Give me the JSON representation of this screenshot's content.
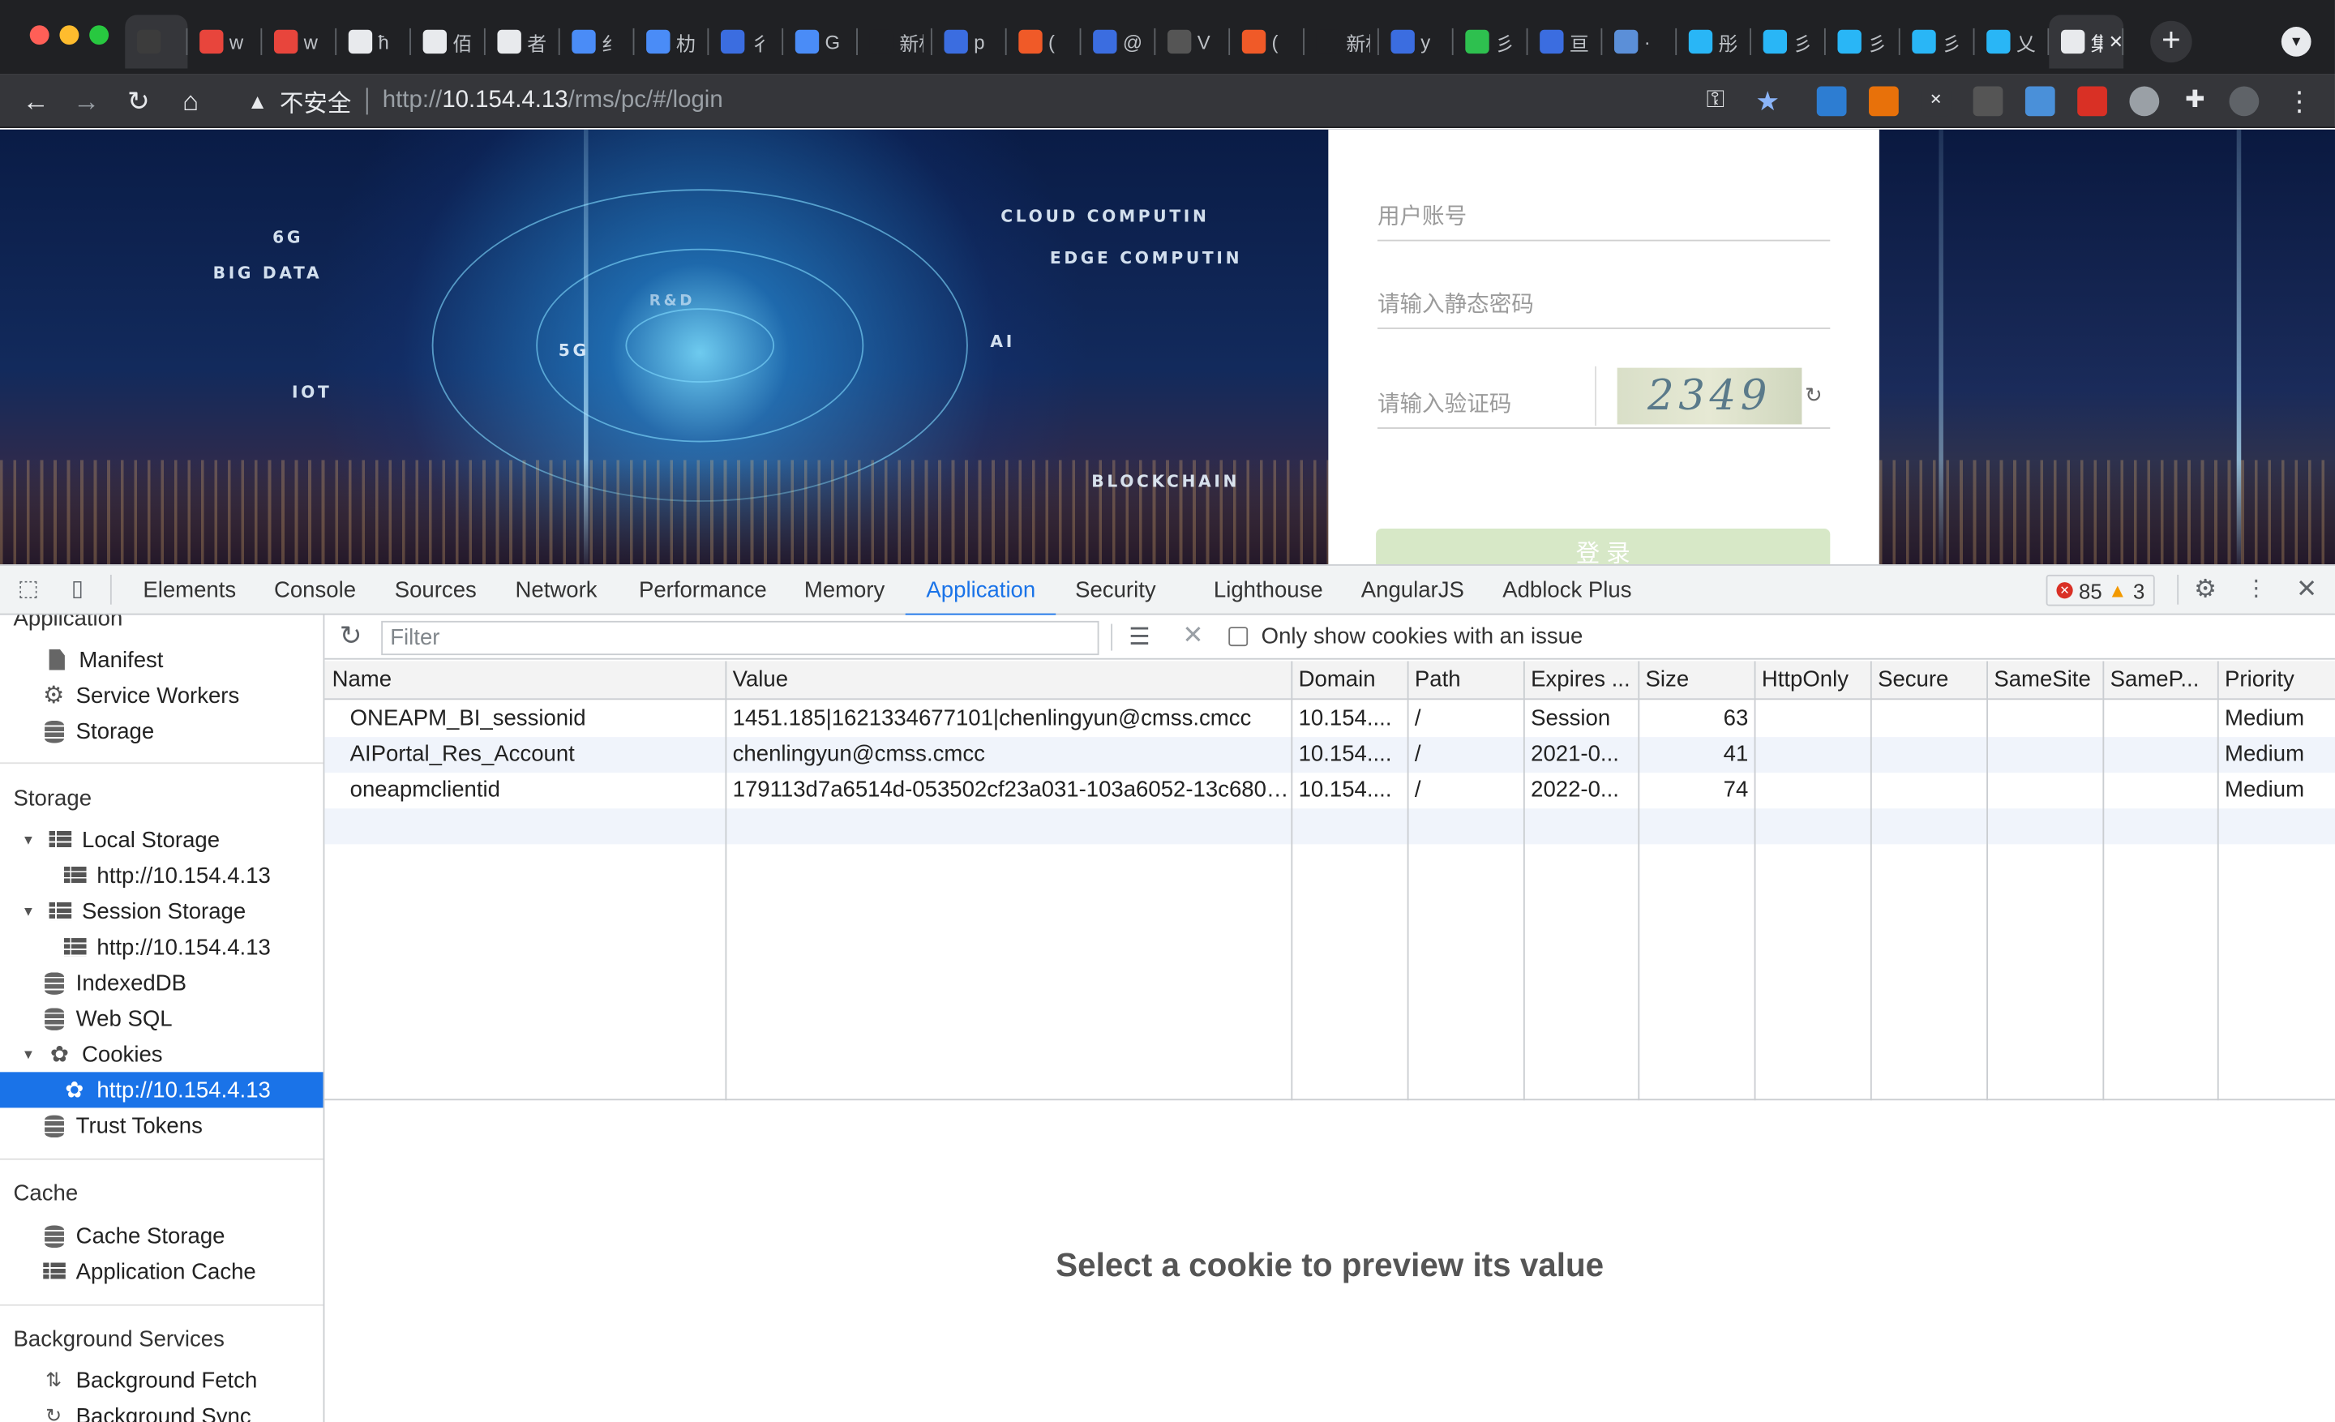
{
  "browser": {
    "tabs": [
      {
        "label": "",
        "color": "#3c3c3c"
      },
      {
        "label": "w",
        "color": "#e8453c"
      },
      {
        "label": "w",
        "color": "#e8453c"
      },
      {
        "label": "ħ",
        "color": "#e8eaed"
      },
      {
        "label": "佰",
        "color": "#e8eaed"
      },
      {
        "label": "者",
        "color": "#e8eaed"
      },
      {
        "label": "纟",
        "color": "#4a8cf7"
      },
      {
        "label": "朸",
        "color": "#4a8cf7"
      },
      {
        "label": "彳",
        "color": "#3b6de0"
      },
      {
        "label": "G",
        "color": "#4a8cf7"
      },
      {
        "label": "新标",
        "color": "#202124"
      },
      {
        "label": "p",
        "color": "#3b6de0"
      },
      {
        "label": "(",
        "color": "#f05a28"
      },
      {
        "label": "@",
        "color": "#3b6de0"
      },
      {
        "label": "V",
        "color": "#555"
      },
      {
        "label": "(",
        "color": "#f05a28"
      },
      {
        "label": "新标",
        "color": "#202124"
      },
      {
        "label": "y",
        "color": "#3b6de0"
      },
      {
        "label": "彡",
        "color": "#2ec04f"
      },
      {
        "label": "亘",
        "color": "#3b6de0"
      },
      {
        "label": "·",
        "color": "#5b8fd8"
      },
      {
        "label": "彤",
        "color": "#29b6f6"
      },
      {
        "label": "彡",
        "color": "#29b6f6"
      },
      {
        "label": "彡",
        "color": "#29b6f6"
      },
      {
        "label": "彡",
        "color": "#29b6f6"
      },
      {
        "label": "乂",
        "color": "#29b6f6"
      },
      {
        "label": "集",
        "color": "#e8eaed",
        "active": true
      }
    ],
    "security_label": "不安全",
    "url_prefix": "http://",
    "url_host": "10.154.4.13",
    "url_path": "/rms/pc/#/login"
  },
  "login": {
    "account_placeholder": "用户账号",
    "password_placeholder": "请输入静态密码",
    "captcha_placeholder": "请输入验证码",
    "captcha_text": "2349",
    "login_button": "登 录",
    "banner_words": [
      "CLOUD COMPUTIN",
      "EDGE COMPUTIN",
      "6G",
      "BIG DATA",
      "5G",
      "AI",
      "IOT",
      "BLOCKCHAIN",
      "R&D"
    ]
  },
  "devtools": {
    "tabs": [
      "Elements",
      "Console",
      "Sources",
      "Network",
      "Performance",
      "Memory",
      "Application",
      "Security",
      "Lighthouse",
      "AngularJS",
      "Adblock Plus"
    ],
    "active_tab": "Application",
    "error_count": "85",
    "warning_count": "3",
    "sidebar": {
      "section_application": "Application",
      "application_items": [
        "Manifest",
        "Service Workers",
        "Storage"
      ],
      "section_storage": "Storage",
      "local_storage": "Local Storage",
      "local_storage_origin": "http://10.154.4.13",
      "session_storage": "Session Storage",
      "session_storage_origin": "http://10.154.4.13",
      "indexeddb": "IndexedDB",
      "websql": "Web SQL",
      "cookies": "Cookies",
      "cookies_origin": "http://10.154.4.13",
      "trust_tokens": "Trust Tokens",
      "section_cache": "Cache",
      "cache_storage": "Cache Storage",
      "application_cache": "Application Cache",
      "section_background": "Background Services",
      "background_fetch": "Background Fetch",
      "background_sync": "Background Sync"
    },
    "filter": {
      "placeholder": "Filter",
      "only_issues_label": "Only show cookies with an issue"
    },
    "columns": [
      "Name",
      "Value",
      "Domain",
      "Path",
      "Expires ...",
      "Size",
      "HttpOnly",
      "Secure",
      "SameSite",
      "SameP...",
      "Priority"
    ],
    "cookies": [
      {
        "name": "ONEAPM_BI_sessionid",
        "value": "1451.185|1621334677101|chenlingyun@cmss.cmcc",
        "domain": "10.154....",
        "path": "/",
        "expires": "Session",
        "size": "63",
        "httponly": "",
        "secure": "",
        "samesite": "",
        "samep": "",
        "priority": "Medium"
      },
      {
        "name": "AIPortal_Res_Account",
        "value": "chenlingyun@cmss.cmcc",
        "domain": "10.154....",
        "path": "/",
        "expires": "2021-0...",
        "size": "41",
        "httponly": "",
        "secure": "",
        "samesite": "",
        "samep": "",
        "priority": "Medium"
      },
      {
        "name": "oneapmclientid",
        "value": "179113d7a6514d-053502cf23a031-103a6052-13c680-...",
        "domain": "10.154....",
        "path": "/",
        "expires": "2022-0...",
        "size": "74",
        "httponly": "",
        "secure": "",
        "samesite": "",
        "samep": "",
        "priority": "Medium"
      }
    ],
    "preview_message": "Select a cookie to preview its value"
  }
}
